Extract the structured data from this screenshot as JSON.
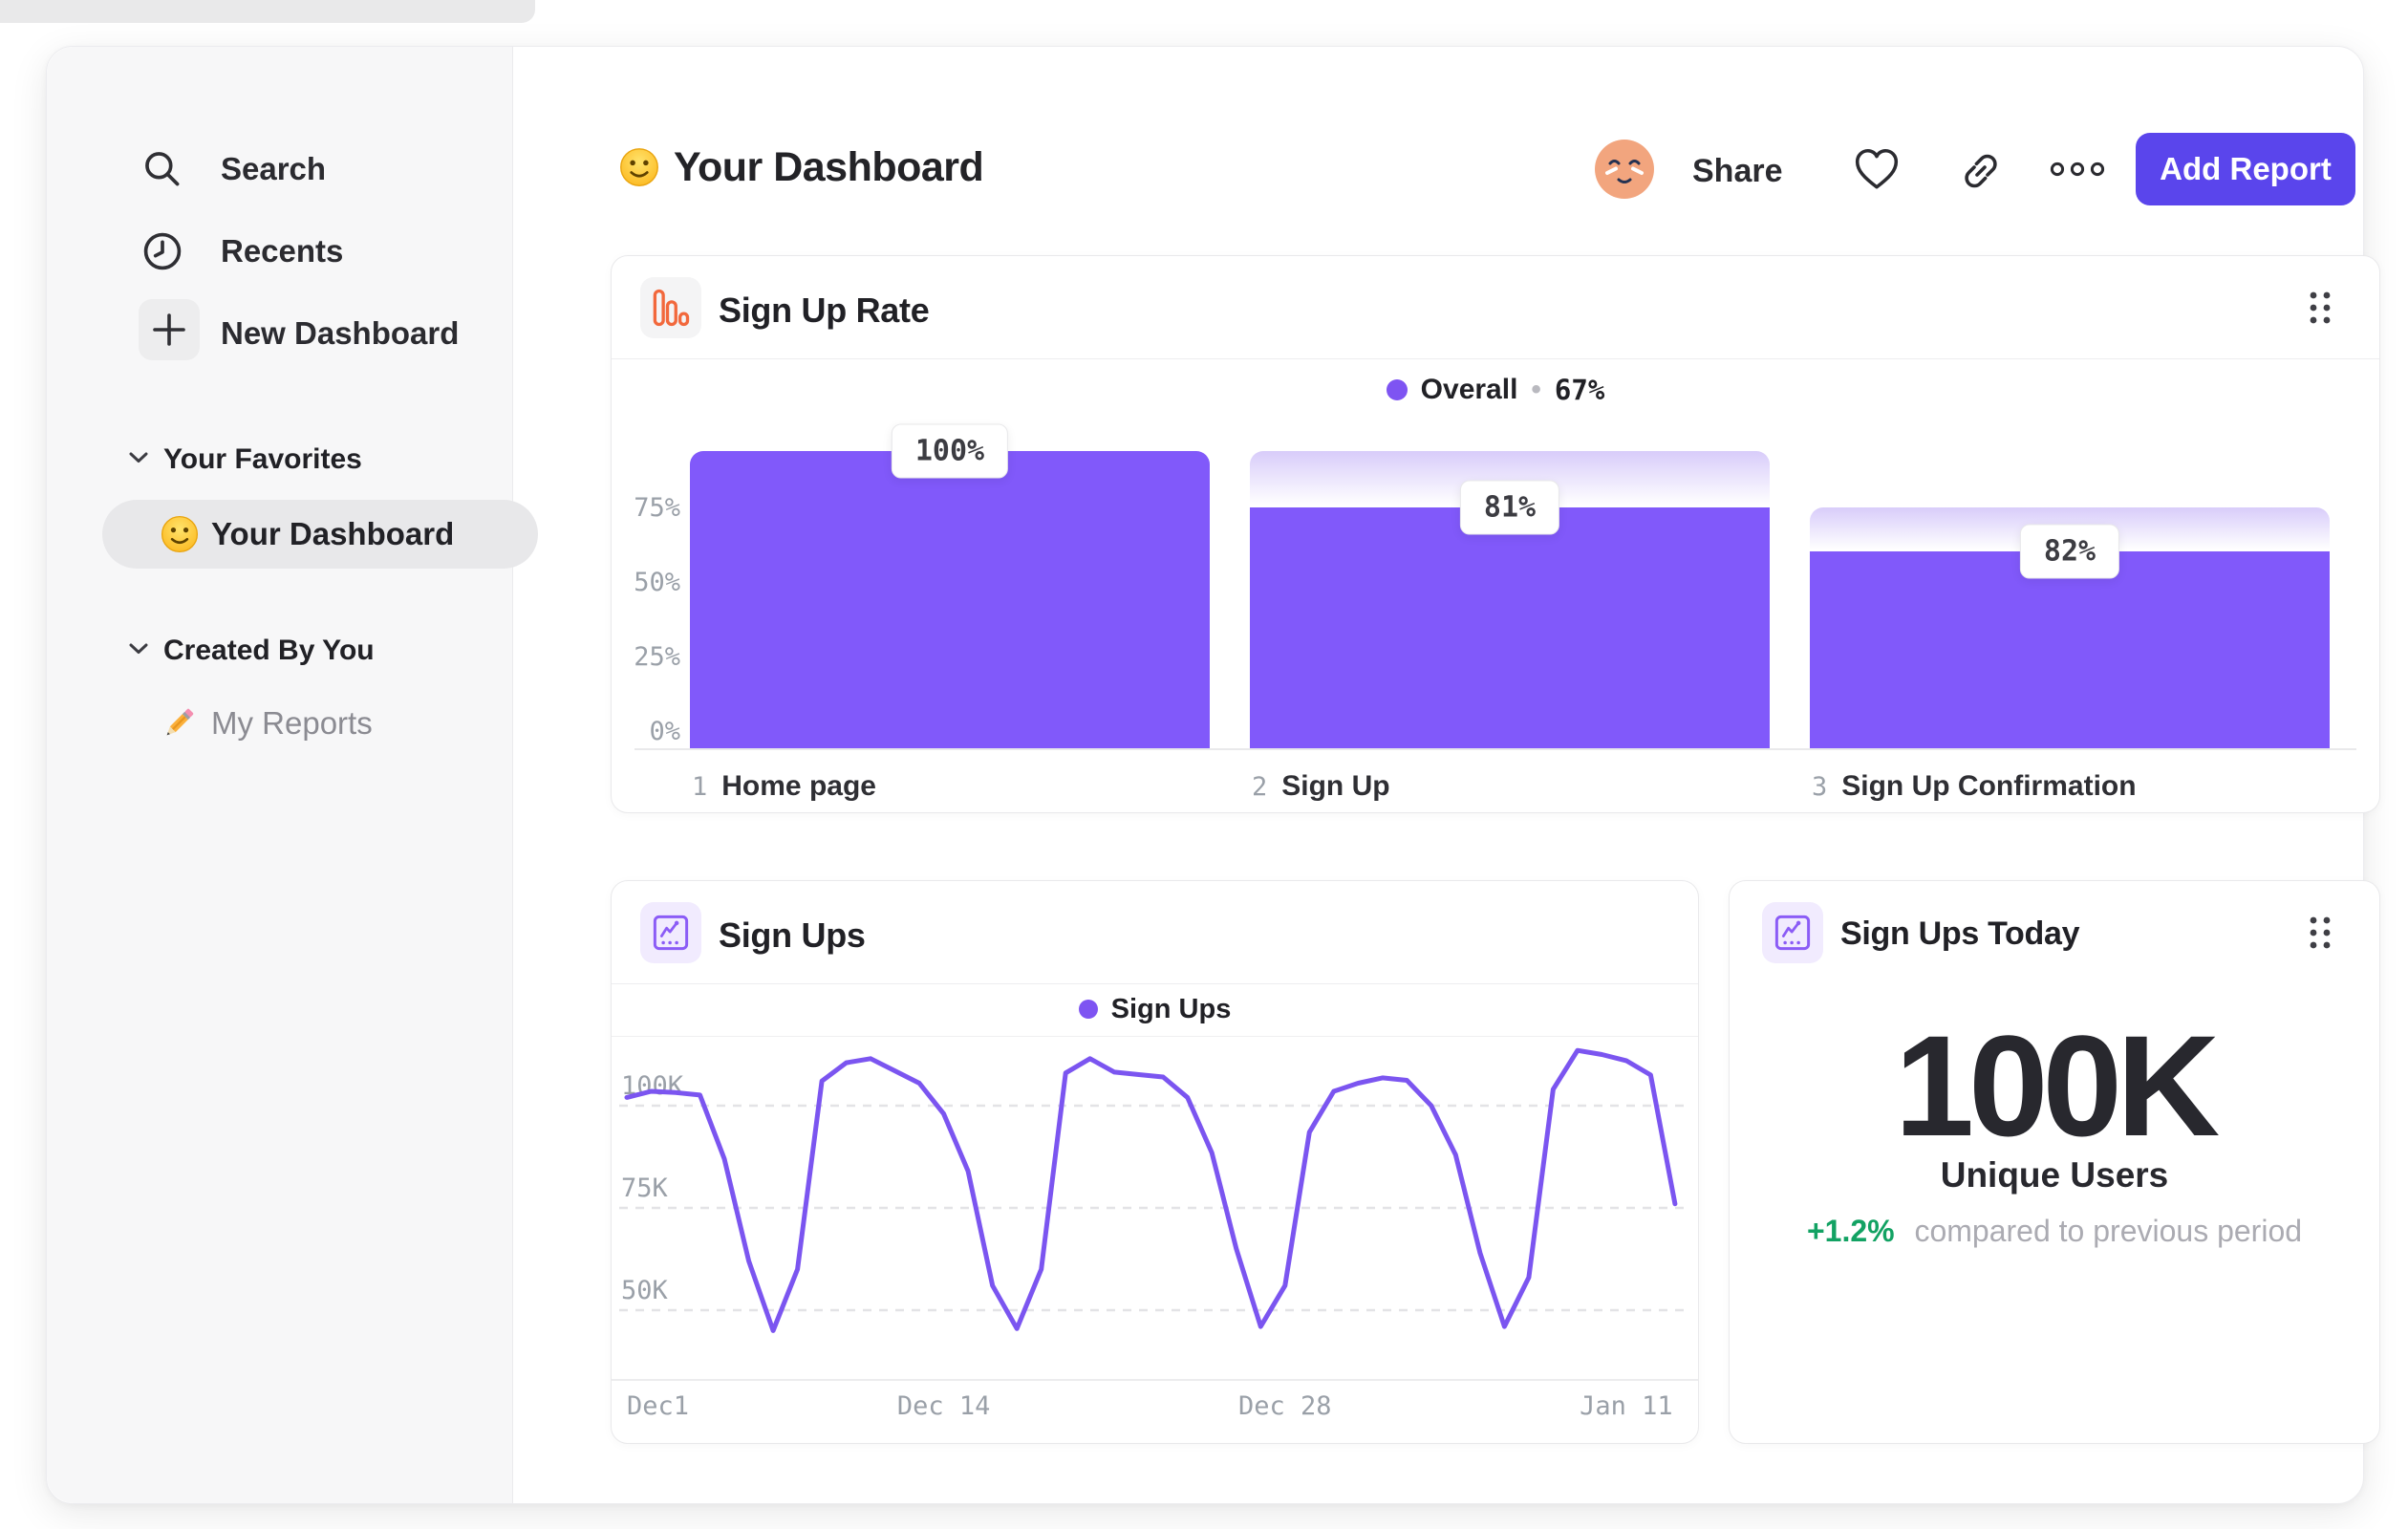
{
  "colors": {
    "accent_purple": "#8159fa",
    "line_purple": "#7b55f0",
    "legend_dot_purple": "#7e54f2",
    "button_indigo": "#5a45ec",
    "icon_orange": "#f2683c",
    "icon_purple": "#8b5cf6",
    "positive_green": "#12a263",
    "sidebar_bg": "#f7f7f8",
    "selected_pill": "#e8e8ea"
  },
  "sidebar": {
    "nav": [
      {
        "icon": "search-icon",
        "label": "Search"
      },
      {
        "icon": "clock-icon",
        "label": "Recents"
      },
      {
        "icon": "plus-icon",
        "label": "New Dashboard"
      }
    ],
    "sections": [
      {
        "title": "Your Favorites",
        "items": [
          {
            "icon": "smiley-emoji",
            "label": "Your Dashboard",
            "selected": true
          }
        ]
      },
      {
        "title": "Created By You",
        "items": [
          {
            "icon": "pencil-emoji",
            "label": "My Reports",
            "selected": false
          }
        ]
      }
    ]
  },
  "header": {
    "emoji": "smiley-emoji",
    "title": "Your Dashboard",
    "share_label": "Share",
    "add_report_label": "Add Report"
  },
  "funnel_card": {
    "title": "Sign Up Rate",
    "legend_label": "Overall",
    "legend_separator": "•",
    "legend_value": "67%"
  },
  "line_card": {
    "title": "Sign Ups",
    "legend_label": "Sign Ups"
  },
  "today_card": {
    "title": "Sign Ups Today",
    "value": "100K",
    "label": "Unique Users",
    "delta": "+1.2%",
    "delta_note": "compared to previous period"
  },
  "chart_data": [
    {
      "type": "bar",
      "title": "Sign Up Rate",
      "legend": {
        "label": "Overall",
        "value": "67%",
        "position": "top-center"
      },
      "categories": [
        "Home page",
        "Sign Up",
        "Sign Up Confirmation"
      ],
      "step_numbers": [
        "1",
        "2",
        "3"
      ],
      "value_labels": [
        "100%",
        "81%",
        "82%"
      ],
      "values_pct_of_total": [
        100,
        81,
        66.4
      ],
      "prev_step_pct_of_total": [
        100,
        100,
        81
      ],
      "overall_conversion": "67%",
      "y_ticks": [
        {
          "label": "75%",
          "value": 75
        },
        {
          "label": "50%",
          "value": 50
        },
        {
          "label": "25%",
          "value": 25
        },
        {
          "label": "0%",
          "value": 0
        }
      ],
      "ylim": [
        0,
        100
      ],
      "grid": false
    },
    {
      "type": "line",
      "title": "Sign Ups",
      "legend": {
        "label": "Sign Ups",
        "position": "top-center"
      },
      "xlabel": "",
      "ylabel": "",
      "x_tick_labels": [
        "Dec1",
        "Dec 14",
        "Dec 28",
        "Jan 11"
      ],
      "x_tick_indices": [
        0,
        13,
        27,
        41
      ],
      "y_ticks": [
        {
          "label": "100K",
          "value": 100
        },
        {
          "label": "75K",
          "value": 75
        },
        {
          "label": "50K",
          "value": 50
        }
      ],
      "values_unit": "thousands_of_sign_ups",
      "values": [
        102,
        103.5,
        103.2,
        102.6,
        87,
        62,
        45,
        60,
        106,
        110.5,
        111.5,
        108.5,
        105.5,
        98,
        84,
        56,
        45.5,
        60,
        108,
        111.5,
        108.2,
        107.6,
        107,
        102,
        88.5,
        65,
        46,
        56,
        93.5,
        103.5,
        105.5,
        106.8,
        106.2,
        100,
        88,
        64,
        46,
        58,
        104,
        113.5,
        112.5,
        111,
        107.5,
        76
      ],
      "grid": "horizontal-dashed"
    }
  ]
}
